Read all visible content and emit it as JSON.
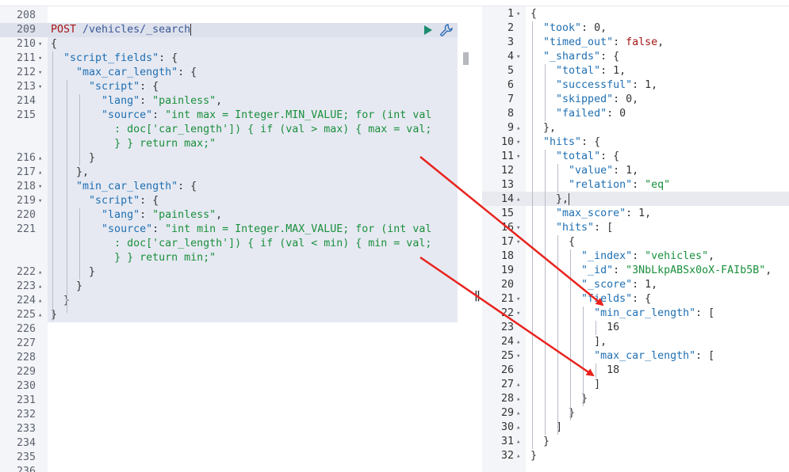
{
  "editor": {
    "method": "POST",
    "path": " /vehicles/_search",
    "lines": [
      {
        "n": "208",
        "fold": "",
        "html": ""
      },
      {
        "n": "209",
        "fold": "",
        "html": "REQ"
      },
      {
        "n": "210",
        "fold": "▾",
        "html": "<span class='pun'>{</span>"
      },
      {
        "n": "211",
        "fold": "▾",
        "html": "  <span class='key'>\"script_fields\"</span><span class='pun'>: {</span>"
      },
      {
        "n": "212",
        "fold": "▾",
        "html": "    <span class='key'>\"max_car_length\"</span><span class='pun'>: {</span>"
      },
      {
        "n": "213",
        "fold": "▾",
        "html": "      <span class='key'>\"script\"</span><span class='pun'>: {</span>"
      },
      {
        "n": "214",
        "fold": "",
        "html": "        <span class='key'>\"lang\"</span><span class='pun'>: </span><span class='str'>\"painless\"</span><span class='pun'>,</span>"
      },
      {
        "n": "215",
        "fold": "",
        "html": "        <span class='key'>\"source\"</span><span class='pun'>: </span><span class='str'>\"int max = Integer.MIN_VALUE; for (int val</span>"
      },
      {
        "n": "",
        "fold": "",
        "html": "          <span class='str'>: doc['car_length']) { if (val &gt; max) { max = val;</span>"
      },
      {
        "n": "",
        "fold": "",
        "html": "          <span class='str'>} } return max;\"</span>"
      },
      {
        "n": "216",
        "fold": "▴",
        "html": "      <span class='pun'>}</span>"
      },
      {
        "n": "217",
        "fold": "▴",
        "html": "    <span class='pun'>},</span>"
      },
      {
        "n": "218",
        "fold": "▾",
        "html": "    <span class='key'>\"min_car_length\"</span><span class='pun'>: {</span>"
      },
      {
        "n": "219",
        "fold": "▾",
        "html": "      <span class='key'>\"script\"</span><span class='pun'>: {</span>"
      },
      {
        "n": "220",
        "fold": "",
        "html": "        <span class='key'>\"lang\"</span><span class='pun'>: </span><span class='str'>\"painless\"</span><span class='pun'>,</span>"
      },
      {
        "n": "221",
        "fold": "",
        "html": "        <span class='key'>\"source\"</span><span class='pun'>: </span><span class='str'>\"int min = Integer.MAX_VALUE; for (int val</span>"
      },
      {
        "n": "",
        "fold": "",
        "html": "          <span class='str'>: doc['car_length']) { if (val &lt; min) { min = val;</span>"
      },
      {
        "n": "",
        "fold": "",
        "html": "          <span class='str'>} } return min;\"</span>"
      },
      {
        "n": "222",
        "fold": "▴",
        "html": "      <span class='pun'>}</span>"
      },
      {
        "n": "223",
        "fold": "▴",
        "html": "    <span class='pun'>}</span>"
      },
      {
        "n": "224",
        "fold": "▴",
        "html": "  <span class='pun'>}</span>"
      },
      {
        "n": "225",
        "fold": "▴",
        "html": "<span class='pun'>}</span>"
      },
      {
        "n": "226",
        "fold": "",
        "html": ""
      },
      {
        "n": "227",
        "fold": "",
        "html": ""
      },
      {
        "n": "228",
        "fold": "",
        "html": ""
      },
      {
        "n": "229",
        "fold": "",
        "html": ""
      },
      {
        "n": "230",
        "fold": "",
        "html": ""
      },
      {
        "n": "231",
        "fold": "",
        "html": ""
      },
      {
        "n": "232",
        "fold": "",
        "html": ""
      },
      {
        "n": "233",
        "fold": "",
        "html": ""
      },
      {
        "n": "234",
        "fold": "",
        "html": ""
      },
      {
        "n": "235",
        "fold": "",
        "html": ""
      },
      {
        "n": "236",
        "fold": "",
        "html": ""
      }
    ]
  },
  "response": {
    "lines": [
      {
        "n": "1",
        "fold": "▾",
        "html": "<span class='pun'>{</span>"
      },
      {
        "n": "2",
        "fold": "",
        "html": "  <span class='key'>\"took\"</span><span class='pun'>: 0,</span>"
      },
      {
        "n": "3",
        "fold": "",
        "html": "  <span class='key'>\"timed_out\"</span><span class='pun'>: </span><span class='bool'>false</span><span class='pun'>,</span>"
      },
      {
        "n": "4",
        "fold": "▾",
        "html": "  <span class='key'>\"_shards\"</span><span class='pun'>: {</span>"
      },
      {
        "n": "5",
        "fold": "",
        "html": "    <span class='key'>\"total\"</span><span class='pun'>: 1,</span>"
      },
      {
        "n": "6",
        "fold": "",
        "html": "    <span class='key'>\"successful\"</span><span class='pun'>: 1,</span>"
      },
      {
        "n": "7",
        "fold": "",
        "html": "    <span class='key'>\"skipped\"</span><span class='pun'>: 0,</span>"
      },
      {
        "n": "8",
        "fold": "",
        "html": "    <span class='key'>\"failed\"</span><span class='pun'>: 0</span>"
      },
      {
        "n": "9",
        "fold": "▴",
        "html": "  <span class='pun'>},</span>"
      },
      {
        "n": "10",
        "fold": "▾",
        "html": "  <span class='key'>\"hits\"</span><span class='pun'>: {</span>"
      },
      {
        "n": "11",
        "fold": "▾",
        "html": "    <span class='key'>\"total\"</span><span class='pun'>: {</span>"
      },
      {
        "n": "12",
        "fold": "",
        "html": "      <span class='key'>\"value\"</span><span class='pun'>: 1,</span>"
      },
      {
        "n": "13",
        "fold": "",
        "html": "      <span class='key'>\"relation\"</span><span class='pun'>: </span><span class='str'>\"eq\"</span>"
      },
      {
        "n": "14",
        "fold": "▴",
        "html": "    <span class='pun'>},</span><span class='caret'></span>"
      },
      {
        "n": "15",
        "fold": "",
        "html": "    <span class='key'>\"max_score\"</span><span class='pun'>: 1,</span>"
      },
      {
        "n": "16",
        "fold": "▾",
        "html": "    <span class='key'>\"hits\"</span><span class='pun'>: [</span>"
      },
      {
        "n": "17",
        "fold": "▾",
        "html": "      <span class='pun'>{</span>"
      },
      {
        "n": "18",
        "fold": "",
        "html": "        <span class='key'>\"_index\"</span><span class='pun'>: </span><span class='str'>\"vehicles\"</span><span class='pun'>,</span>"
      },
      {
        "n": "19",
        "fold": "",
        "html": "        <span class='key'>\"_id\"</span><span class='pun'>: </span><span class='str'>\"3NbLkpABSx0oX-FAIb5B\"</span><span class='pun'>,</span>"
      },
      {
        "n": "20",
        "fold": "",
        "html": "        <span class='key'>\"_score\"</span><span class='pun'>: 1,</span>"
      },
      {
        "n": "21",
        "fold": "▾",
        "html": "        <span class='key'>\"fields\"</span><span class='pun'>: {</span>"
      },
      {
        "n": "22",
        "fold": "▾",
        "html": "          <span class='key'>\"min_car_length\"</span><span class='pun'>: [</span>"
      },
      {
        "n": "23",
        "fold": "",
        "html": "            <span class='num'>16</span>"
      },
      {
        "n": "24",
        "fold": "▴",
        "html": "          <span class='pun'>],</span>"
      },
      {
        "n": "25",
        "fold": "▾",
        "html": "          <span class='key'>\"max_car_length\"</span><span class='pun'>: [</span>"
      },
      {
        "n": "26",
        "fold": "",
        "html": "            <span class='num'>18</span>"
      },
      {
        "n": "27",
        "fold": "▴",
        "html": "          <span class='pun'>]</span>"
      },
      {
        "n": "28",
        "fold": "▴",
        "html": "        <span class='pun'>}</span>"
      },
      {
        "n": "29",
        "fold": "▴",
        "html": "      <span class='pun'>}</span>"
      },
      {
        "n": "30",
        "fold": "▴",
        "html": "    <span class='pun'>]</span>"
      },
      {
        "n": "31",
        "fold": "▴",
        "html": "  <span class='pun'>}</span>"
      },
      {
        "n": "32",
        "fold": "▴",
        "html": "<span class='pun'>}</span>"
      }
    ]
  },
  "colors": {
    "arrow": "#e8231e",
    "run": "#1b8c6e",
    "key": "#1f6fb2",
    "string": "#1a8f3c"
  }
}
